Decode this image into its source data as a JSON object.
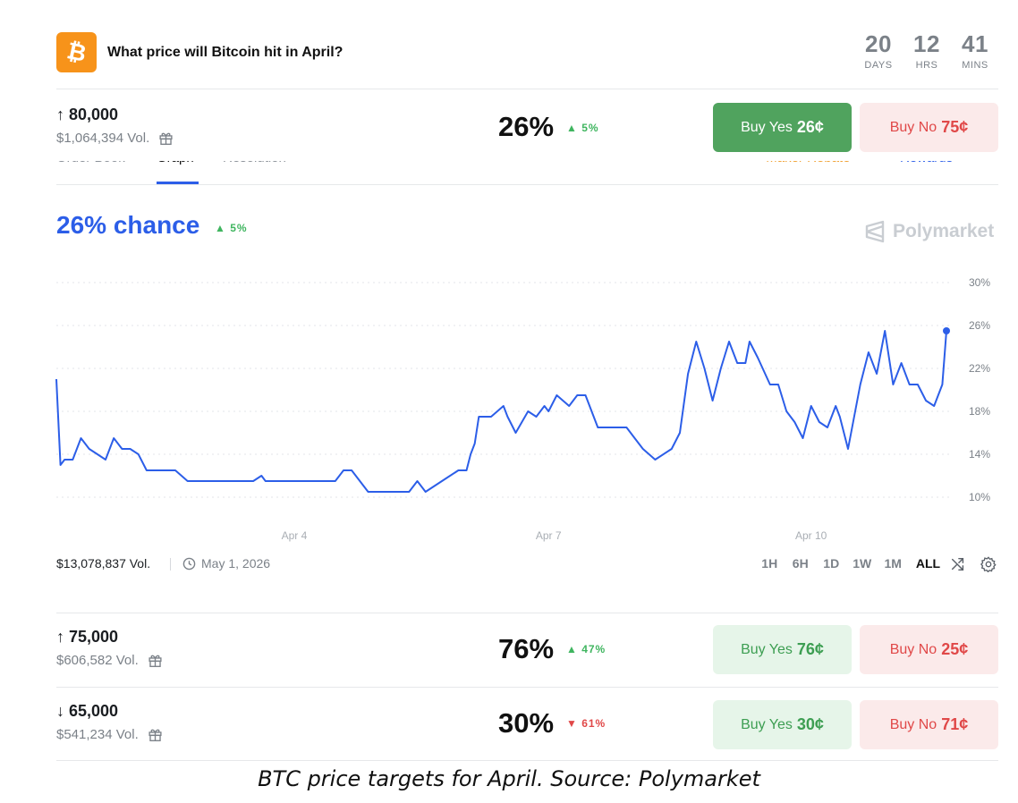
{
  "header": {
    "logo_symbol": "₿",
    "title": "What price will Bitcoin hit in April?",
    "countdown": [
      {
        "value": "20",
        "label": "DAYS"
      },
      {
        "value": "12",
        "label": "HRS"
      },
      {
        "value": "41",
        "label": "MINS"
      }
    ]
  },
  "markets": [
    {
      "name": "↑ 80,000",
      "volume": "$1,064,394 Vol.",
      "chance": "26%",
      "change": "▲ 5%",
      "direction": "up",
      "yes_label": "Buy Yes",
      "yes_price": "26¢",
      "no_label": "Buy No",
      "no_price": "75¢"
    },
    {
      "name": "↑ 75,000",
      "volume": "$606,582 Vol.",
      "chance": "76%",
      "change": "▲ 47%",
      "direction": "up",
      "yes_label": "Buy Yes",
      "yes_price": "76¢",
      "no_label": "Buy No",
      "no_price": "25¢"
    },
    {
      "name": "↓ 65,000",
      "volume": "$541,234 Vol.",
      "chance": "30%",
      "change": "▼ 61%",
      "direction": "down",
      "yes_label": "Buy Yes",
      "yes_price": "30¢",
      "no_label": "Buy No",
      "no_price": "71¢"
    }
  ],
  "tabs": {
    "items": [
      "Order Book",
      "Graph",
      "Resolution"
    ],
    "active": "Graph",
    "right_items": [
      "Maker Rebate",
      "Rewards"
    ]
  },
  "graph": {
    "chance_text": "26% chance",
    "change": "▲ 5%",
    "brand": "Polymarket",
    "total_volume": "$13,078,837 Vol.",
    "end_date": "May 1, 2026",
    "ranges": [
      "1H",
      "6H",
      "1D",
      "1W",
      "1M",
      "ALL"
    ],
    "selected_range": "ALL"
  },
  "caption": "BTC price targets for April. Source: Polymarket",
  "colors": {
    "accent": "#2c5ee8",
    "yes": "#50a35e",
    "no": "#e04848",
    "up": "#3fb55f",
    "btc": "#f7931a"
  },
  "chart_data": {
    "type": "line",
    "series": [
      {
        "x": [
          0,
          0.05,
          0.1,
          0.2,
          0.3,
          0.4,
          0.5,
          0.6,
          0.7,
          0.8,
          0.9,
          1.0,
          1.1,
          1.2,
          1.3,
          1.35,
          1.45,
          1.6,
          1.8,
          2.0,
          2.2,
          2.4,
          2.5,
          2.55,
          2.65,
          2.75,
          2.8,
          2.9,
          3.2,
          3.4,
          3.5,
          3.6,
          3.8,
          4.0,
          4.3,
          4.4,
          4.5,
          4.7,
          4.9,
          5.0,
          5.05,
          5.1,
          5.15,
          5.3,
          5.45,
          5.5,
          5.6,
          5.75,
          5.85,
          5.95,
          6.0,
          6.1,
          6.25,
          6.35,
          6.45,
          6.6,
          6.75,
          6.8,
          6.85,
          6.95,
          7.05,
          7.15,
          7.3,
          7.5,
          7.6,
          7.7,
          7.8,
          7.9,
          8.0,
          8.1,
          8.2,
          8.3,
          8.4,
          8.45,
          8.55,
          8.7,
          8.8,
          8.9,
          9.0,
          9.1,
          9.2,
          9.3,
          9.4,
          9.5,
          9.55,
          9.65,
          9.8,
          9.9,
          10.0,
          10.1,
          10.2,
          10.3,
          10.4,
          10.5,
          10.6,
          10.7,
          10.8,
          10.85
        ],
        "y": [
          21,
          13,
          13.5,
          13.5,
          15.5,
          14.5,
          14,
          13.5,
          15.5,
          14.5,
          14.5,
          14,
          12.5,
          12.5,
          12.5,
          12.5,
          12.5,
          11.5,
          11.5,
          11.5,
          11.5,
          11.5,
          12,
          11.5,
          11.5,
          11.5,
          11.5,
          11.5,
          11.5,
          11.5,
          12.5,
          12.5,
          10.5,
          10.5,
          10.5,
          11.5,
          10.5,
          11.5,
          12.5,
          12.5,
          14,
          15,
          17.5,
          17.5,
          18.5,
          17.5,
          16,
          18,
          17.5,
          18.5,
          18,
          19.5,
          18.5,
          19.5,
          19.5,
          16.5,
          16.5,
          16.5,
          16.5,
          16.5,
          15.5,
          14.5,
          13.5,
          14.5,
          16,
          21.5,
          24.5,
          22,
          19,
          22,
          24.5,
          22.5,
          22.5,
          24.5,
          23,
          20.5,
          20.5,
          18,
          17,
          15.5,
          18.5,
          17,
          16.5,
          18.5,
          17.5,
          14.5,
          20.5,
          23.5,
          21.5,
          25.5,
          20.5,
          22.5,
          20.5,
          20.5,
          19,
          18.5,
          20.5,
          25.5
        ]
      }
    ],
    "x_tick_labels": [
      "Apr 4",
      "Apr 7",
      "Apr 10"
    ],
    "x_ticks": [
      2.9,
      6.0,
      9.2
    ],
    "y_ticks": [
      10,
      14,
      18,
      22,
      26,
      30
    ],
    "y_tick_labels": [
      "10%",
      "14%",
      "18%",
      "22%",
      "26%",
      "30%"
    ],
    "ylim": [
      8.5,
      31
    ],
    "xlim": [
      0,
      10.85
    ],
    "grid": true,
    "line_color": "#2c5ee8"
  }
}
